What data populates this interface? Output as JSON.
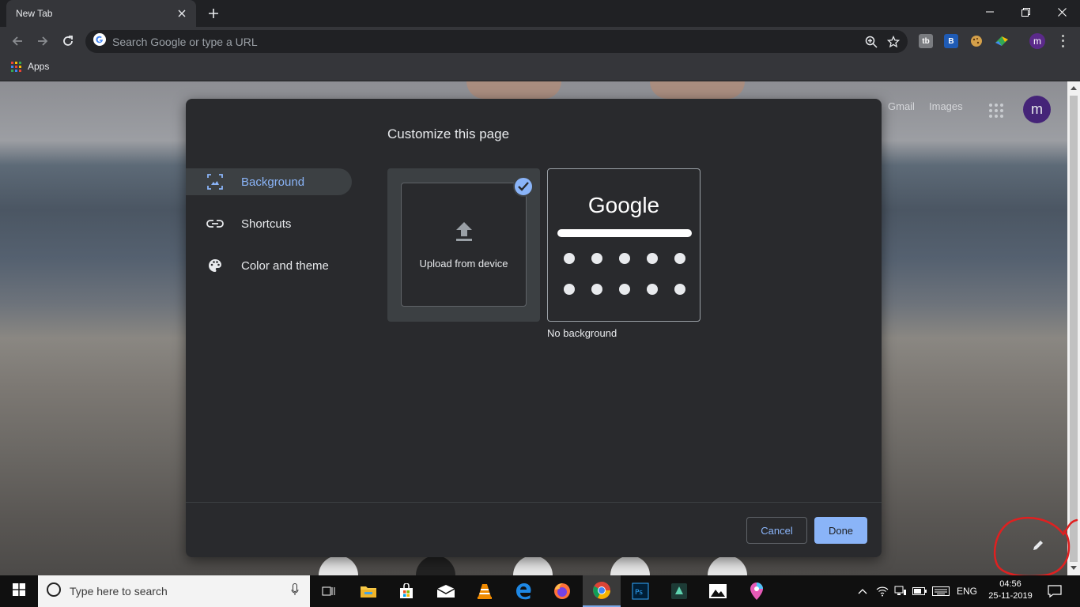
{
  "browser": {
    "tab_title": "New Tab",
    "omnibox_placeholder": "Search Google or type a URL",
    "profile_initial": "m",
    "bookmarks": {
      "apps_label": "Apps"
    }
  },
  "ntp": {
    "gmail": "Gmail",
    "images": "Images",
    "avatar_initial": "m"
  },
  "dialog": {
    "title": "Customize this page",
    "nav": [
      {
        "label": "Background",
        "icon": "image-icon",
        "active": true
      },
      {
        "label": "Shortcuts",
        "icon": "link-icon",
        "active": false
      },
      {
        "label": "Color and theme",
        "icon": "palette-icon",
        "active": false
      }
    ],
    "tiles": {
      "upload_label": "Upload from device",
      "no_background_logo": "Google",
      "no_background_label": "No background"
    },
    "buttons": {
      "cancel": "Cancel",
      "done": "Done"
    }
  },
  "taskbar": {
    "search_placeholder": "Type here to search",
    "language": "ENG",
    "time": "04:56",
    "date": "25-11-2019"
  },
  "colors": {
    "accent": "#8ab4f8",
    "dialog_bg": "#292a2d",
    "annotation": "#e02020"
  }
}
